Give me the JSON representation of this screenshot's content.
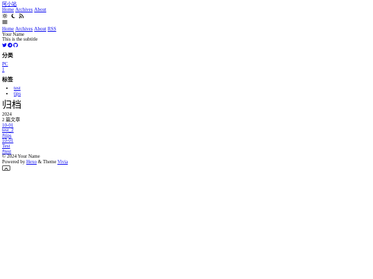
{
  "header": {
    "site_title": "阿小站",
    "nav": [
      "Home",
      "Archives",
      "About"
    ]
  },
  "toolbar": {
    "icons": [
      "sun-icon",
      "moon-icon",
      "rss-icon"
    ]
  },
  "mobile_nav": {
    "items": [
      "Home",
      "Archives",
      "About",
      "RSS"
    ]
  },
  "profile": {
    "name": "Your Name",
    "subtitle": "This is the subtitle",
    "social_icons": [
      "twitter-icon",
      "telegram-icon",
      "github-icon"
    ]
  },
  "categories": {
    "heading": "分类",
    "items": [
      "PC",
      "1"
    ]
  },
  "tags": {
    "heading": "标签",
    "items": [
      "test",
      "tips"
    ]
  },
  "archive": {
    "title": "归档",
    "year": "2024",
    "count_text": "2 篇文章",
    "posts": [
      {
        "date": "10-01",
        "title": "test_2",
        "tag": "#tips"
      },
      {
        "date": "10-01",
        "title": "Test",
        "tag": "#test"
      }
    ]
  },
  "footer": {
    "copyright": "© 2024 Your Name",
    "powered_prefix": "Powered by",
    "hexo": "Hexo",
    "theme_mid": "& Theme",
    "theme": "Vivia"
  },
  "colors": {
    "link": "#0000ee",
    "text": "#000000"
  }
}
